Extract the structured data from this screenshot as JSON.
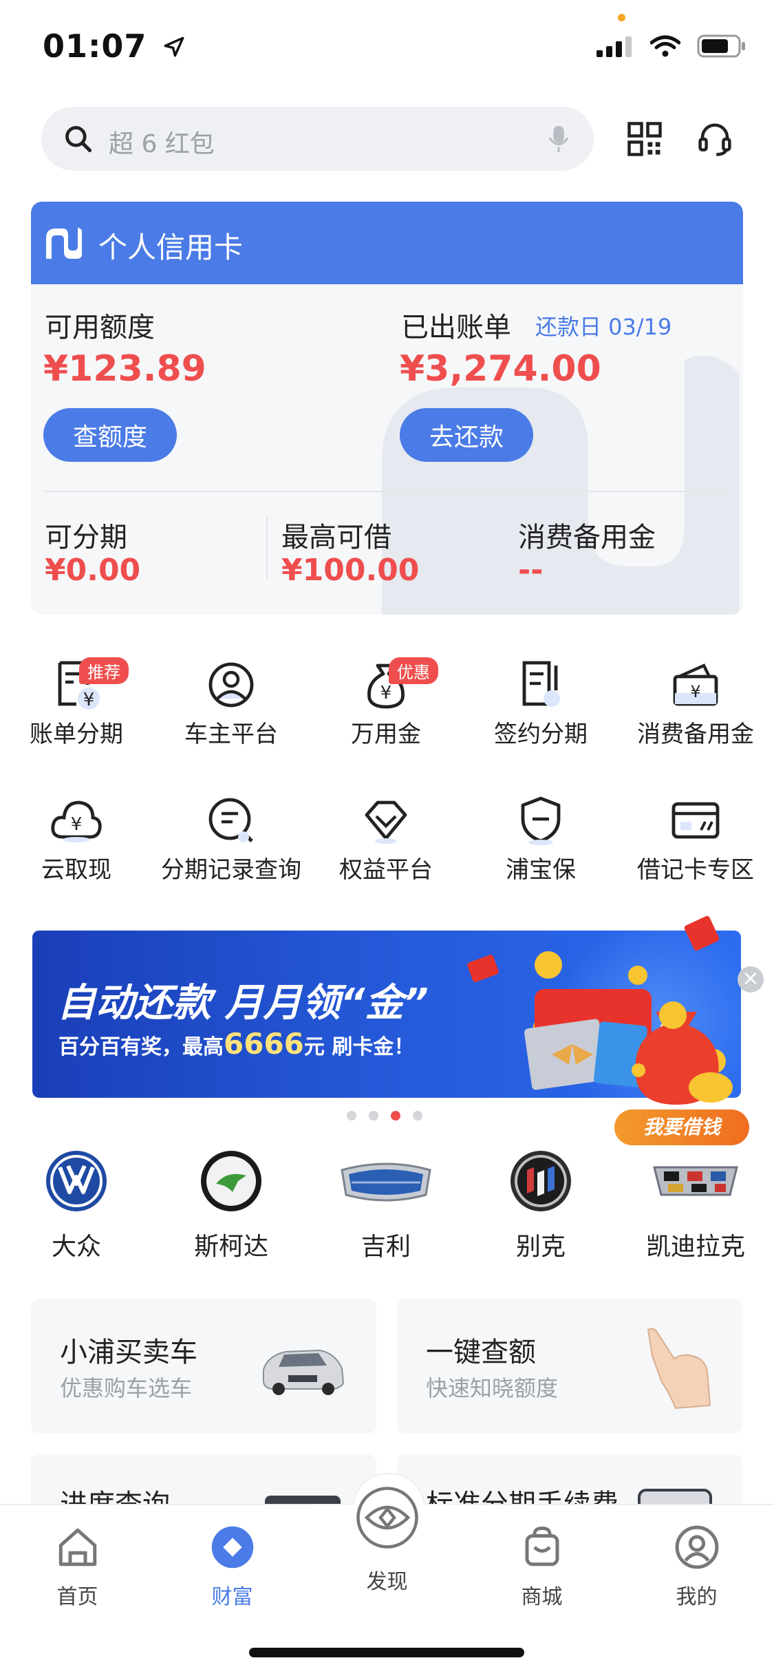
{
  "status": {
    "time": "01:07"
  },
  "search": {
    "placeholder": "超 6 红包"
  },
  "card": {
    "title": "个人信用卡",
    "available_label": "可用额度",
    "available_amount": "¥123.89",
    "check_button": "查额度",
    "bill_label": "已出账单",
    "due_date": "还款日 03/19",
    "bill_amount": "¥3,274.00",
    "repay_button": "去还款",
    "installment_label": "可分期",
    "installment_amount": "¥0.00",
    "max_loan_label": "最高可借",
    "max_loan_amount": "¥100.00",
    "reserve_label": "消费备用金",
    "reserve_amount": "--"
  },
  "grid": {
    "row1": [
      {
        "label": "账单分期",
        "badge": "推荐",
        "icon": "bill-installment-icon"
      },
      {
        "label": "车主平台",
        "icon": "car-owner-icon"
      },
      {
        "label": "万用金",
        "badge": "优惠",
        "icon": "money-bag-icon"
      },
      {
        "label": "签约分期",
        "icon": "contract-icon"
      },
      {
        "label": "消费备用金",
        "icon": "wallet-icon"
      }
    ],
    "row2": [
      {
        "label": "云取现",
        "icon": "cloud-cash-icon"
      },
      {
        "label": "分期记录查询",
        "icon": "record-search-icon"
      },
      {
        "label": "权益平台",
        "icon": "diamond-icon"
      },
      {
        "label": "浦宝保",
        "icon": "shield-icon"
      },
      {
        "label": "借记卡专区",
        "icon": "debit-card-icon"
      }
    ]
  },
  "banner": {
    "headline": "自动还款 月月领“金”",
    "sub_prefix": "百分百有奖，最高",
    "sub_number": "6666",
    "sub_suffix": "元 刷卡金！",
    "float_label": "我要借钱"
  },
  "brands": [
    {
      "label": "大众",
      "icon": "volkswagen-logo-icon"
    },
    {
      "label": "斯柯达",
      "icon": "skoda-logo-icon"
    },
    {
      "label": "吉利",
      "icon": "geely-logo-icon"
    },
    {
      "label": "别克",
      "icon": "buick-logo-icon"
    },
    {
      "label": "凯迪拉克",
      "icon": "cadillac-logo-icon"
    }
  ],
  "services": [
    {
      "title": "小浦买卖车",
      "subtitle": "优惠购车选车"
    },
    {
      "title": "一键查额",
      "subtitle": "快速知晓额度"
    },
    {
      "title": "进度查询",
      "subtitle": ""
    },
    {
      "title": "标准分期手续费",
      "subtitle": ""
    }
  ],
  "tabs": [
    {
      "label": "首页",
      "icon": "home-icon"
    },
    {
      "label": "财富",
      "icon": "wealth-icon",
      "active": true
    },
    {
      "label": "发现",
      "icon": "discover-icon"
    },
    {
      "label": "商城",
      "icon": "shop-bag-icon"
    },
    {
      "label": "我的",
      "icon": "profile-icon"
    }
  ],
  "colors": {
    "accent": "#4a7be6",
    "red": "#ef4e4e",
    "card_bg": "#f6f7f9"
  }
}
